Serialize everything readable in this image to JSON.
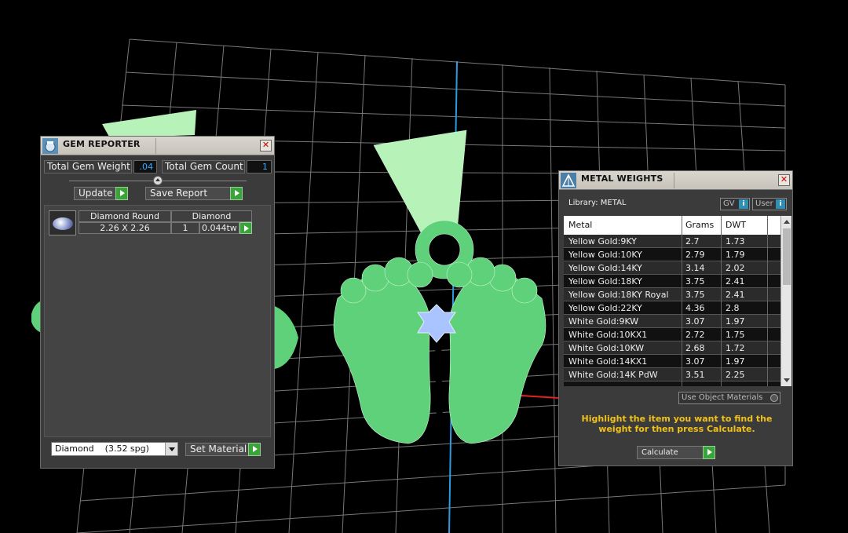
{
  "gem_reporter": {
    "title": "GEM REPORTER",
    "total_gem_weight_label": "Total Gem Weight",
    "total_gem_weight_value": ".04",
    "total_gem_count_label": "Total Gem Count",
    "total_gem_count_value": "1",
    "update_label": "Update",
    "save_report_label": "Save Report",
    "gem": {
      "name": "Diamond Round",
      "material": "Diamond",
      "size": "2.26 X 2.26",
      "count": "1",
      "weight": "0.044tw"
    },
    "material_select": "Diamond    (3.52 spg)",
    "set_material_label": "Set Material"
  },
  "metal_weights": {
    "title": "METAL WEIGHTS",
    "library_label": "Library: METAL",
    "gv_label": "GV",
    "user_label": "User",
    "columns": [
      "Metal",
      "Grams",
      "DWT"
    ],
    "rows": [
      {
        "metal": "Yellow Gold:9KY",
        "grams": "2.7",
        "dwt": "1.73"
      },
      {
        "metal": "Yellow Gold:10KY",
        "grams": "2.79",
        "dwt": "1.79"
      },
      {
        "metal": "Yellow Gold:14KY",
        "grams": "3.14",
        "dwt": "2.02"
      },
      {
        "metal": "Yellow Gold:18KY",
        "grams": "3.75",
        "dwt": "2.41"
      },
      {
        "metal": "Yellow Gold:18KY Royal",
        "grams": "3.75",
        "dwt": "2.41"
      },
      {
        "metal": "Yellow Gold:22KY",
        "grams": "4.36",
        "dwt": "2.8"
      },
      {
        "metal": "White Gold:9KW",
        "grams": "3.07",
        "dwt": "1.97"
      },
      {
        "metal": "White Gold:10KX1",
        "grams": "2.72",
        "dwt": "1.75"
      },
      {
        "metal": "White Gold:10KW",
        "grams": "2.68",
        "dwt": "1.72"
      },
      {
        "metal": "White Gold:14KX1",
        "grams": "3.07",
        "dwt": "1.97"
      },
      {
        "metal": "White Gold:14K PdW",
        "grams": "3.51",
        "dwt": "2.25"
      }
    ],
    "use_object_materials_label": "Use Object Materials",
    "hint": "Highlight the item you want to find the weight for then press Calculate.",
    "calculate_label": "Calculate"
  },
  "colors": {
    "background": "#000000",
    "grid": "#9a9a9a",
    "model_green": "#5ed17a",
    "gem_blue": "#a9c4ff",
    "hint_yellow": "#f2c21a",
    "value_blue": "#37a8ff",
    "go_green": "#3aa33a"
  }
}
